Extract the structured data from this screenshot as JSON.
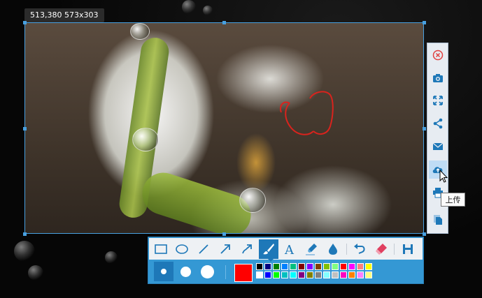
{
  "selection_info": "513,380 573x303",
  "sidebar": {
    "buttons": [
      {
        "name": "close-icon",
        "color": "#e04040"
      },
      {
        "name": "camera-icon",
        "color": "#1e78b8"
      },
      {
        "name": "fullscreen-icon",
        "color": "#1e78b8"
      },
      {
        "name": "share-icon",
        "color": "#1e78b8"
      },
      {
        "name": "mail-icon",
        "color": "#1e78b8"
      },
      {
        "name": "cloud-upload-icon",
        "color": "#1e78b8"
      },
      {
        "name": "print-icon",
        "color": "#1e78b8"
      },
      {
        "name": "copy-icon",
        "color": "#1e78b8"
      }
    ],
    "tooltip": "上传"
  },
  "toolbar": {
    "tools": [
      "rectangle-icon",
      "ellipse-icon",
      "line-icon",
      "arrow-icon",
      "curved-arrow-icon",
      "brush-icon",
      "text-icon",
      "highlighter-icon",
      "blur-icon",
      "undo-icon",
      "eraser-icon",
      "save-icon"
    ],
    "active_tool": "brush-icon",
    "brush_sizes": [
      "small",
      "medium",
      "large"
    ],
    "active_size": "small",
    "current_color": "#ff0000",
    "palette": [
      "#000000",
      "#000080",
      "#008000",
      "#0080ff",
      "#00c080",
      "#800000",
      "#8000ff",
      "#804000",
      "#80c000",
      "#80ff80",
      "#ff0000",
      "#ff00ff",
      "#ff8080",
      "#ffff00",
      "#ffffff",
      "#0000ff",
      "#00ff00",
      "#00c0c0",
      "#00ffff",
      "#800080",
      "#808000",
      "#808080",
      "#80ffff",
      "#c0c0c0",
      "#ff00c0",
      "#ff8000",
      "#ff80ff",
      "#ffff80"
    ]
  }
}
